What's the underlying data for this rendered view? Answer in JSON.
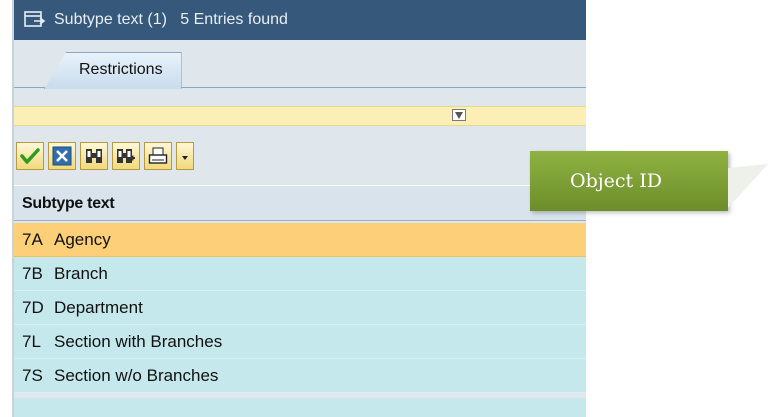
{
  "window": {
    "title": "Subtype text (1)   5 Entries found"
  },
  "tabs": [
    {
      "label": "Restrictions"
    }
  ],
  "toolbar": {
    "icons": [
      "checkmark-icon",
      "cancel-icon",
      "find-icon",
      "find-next-icon",
      "print-icon",
      "dropdown-arrow-icon"
    ]
  },
  "table": {
    "column_header": "Subtype text",
    "rows": [
      {
        "code": "7A",
        "label": "Agency",
        "selected": true
      },
      {
        "code": "7B",
        "label": "Branch",
        "selected": false
      },
      {
        "code": "7D",
        "label": "Department",
        "selected": false
      },
      {
        "code": "7L",
        "label": "Section with Branches",
        "selected": false
      },
      {
        "code": "7S",
        "label": "Section w/o Branches",
        "selected": false
      }
    ]
  },
  "callout": {
    "text": "Object ID"
  },
  "colors": {
    "title_bar": "#36587a",
    "selected_row": "#fccf78",
    "row_bg": "#c5e8ec",
    "callout": "#7a9c33"
  }
}
